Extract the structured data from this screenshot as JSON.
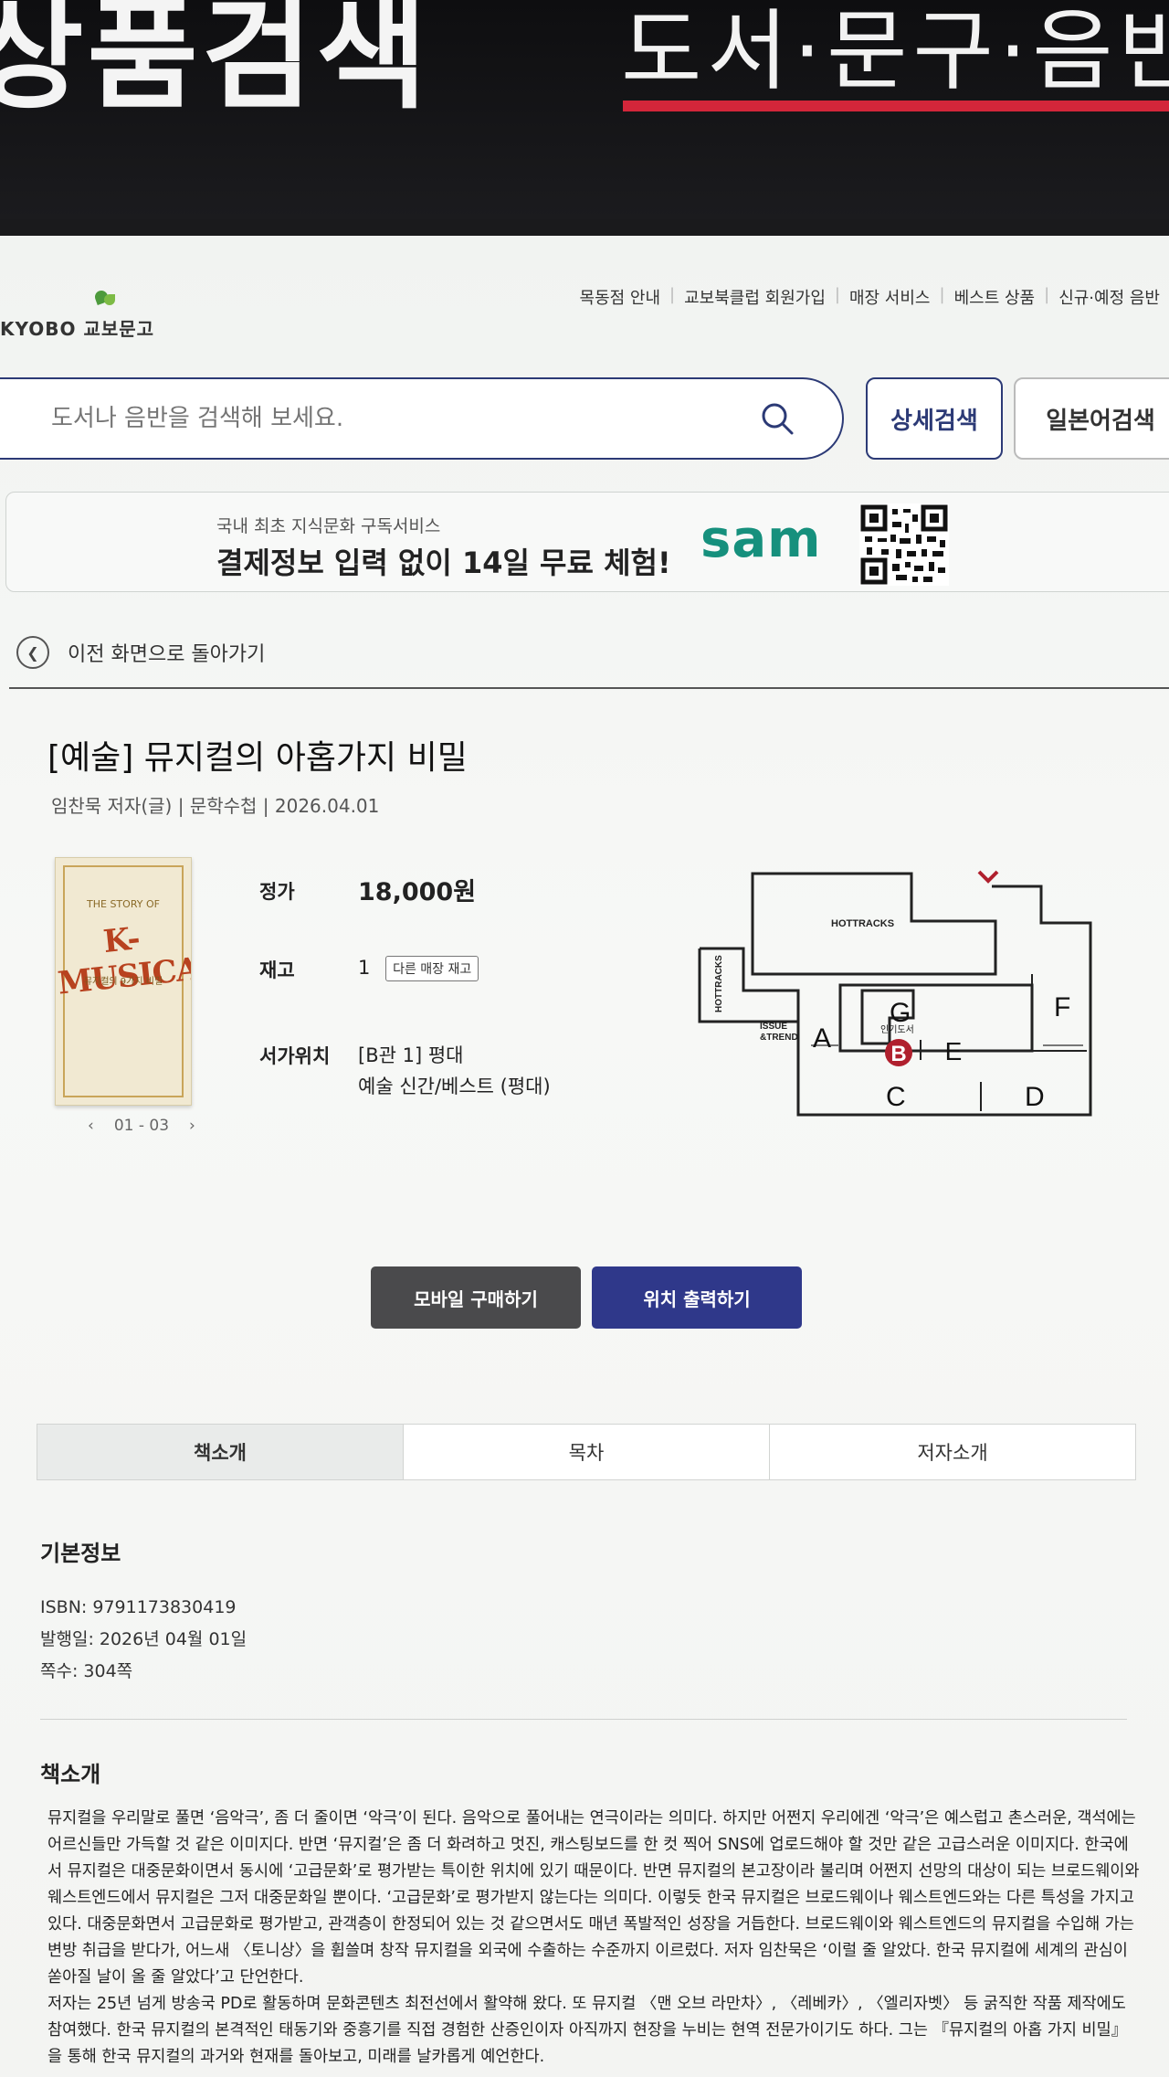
{
  "signage": {
    "left_text": "상품검색",
    "right_text": "도서·문구·음반"
  },
  "header": {
    "logo": "KYOBO 교보문고",
    "nav": [
      "목동점 안내",
      "교보북클럽 회원가입",
      "매장 서비스",
      "베스트 상품",
      "신규·예정 음반"
    ]
  },
  "search": {
    "placeholder": "도서나 음반을 검색해 보세요.",
    "detail_label": "상세검색",
    "japanese_label": "일본어검색"
  },
  "banner": {
    "subtitle": "국내 최초 지식문화 구독서비스",
    "headline": "결제정보 입력 없이 14일 무료 체험!",
    "brand": "sam"
  },
  "back_label": "이전 화면으로 돌아가기",
  "book": {
    "title": "[예술] 뮤지컬의 아홉가지 비밀",
    "meta": "임찬묵 저자(글) | 문학수첩 | 2026.04.01",
    "cover": {
      "small": "THE STORY OF",
      "main": "K-MUSICAL",
      "sub": "뮤지컬의 9가지 비밀"
    },
    "pager": "01 - 03",
    "price_label": "정가",
    "price": "18,000원",
    "stock_label": "재고",
    "stock": "1",
    "other_store_label": "다른 매장 재고",
    "shelf_label": "서가위치",
    "shelf_line1": "[B관 1] 평대",
    "shelf_line2": "예술 신간/베스트 (평대)"
  },
  "store_map": {
    "labels": {
      "hottracks_top": "HOTTRACKS",
      "hottracks_side": "HOTTRACKS",
      "issue": "ISSUE",
      "trend": "&TREND",
      "popular": "인기도서",
      "A": "A",
      "B": "B",
      "C": "C",
      "D": "D",
      "E": "E",
      "F": "F",
      "G": "G"
    },
    "highlight": "B",
    "highlight_color": "#b0202e"
  },
  "actions": {
    "mobile_buy": "모바일 구매하기",
    "print_location": "위치 출력하기"
  },
  "tabs": [
    {
      "label": "책소개",
      "active": true
    },
    {
      "label": "목차",
      "active": false
    },
    {
      "label": "저자소개",
      "active": false
    }
  ],
  "basic_info": {
    "title": "기본정보",
    "isbn": "ISBN: 9791173830419",
    "published": "발행일: 2026년 04월 01일",
    "pages": "쪽수: 304쪽"
  },
  "intro": {
    "title": "책소개",
    "p1": "뮤지컬을 우리말로 풀면 ‘음악극’, 좀 더 줄이면 ‘악극’이 된다. 음악으로 풀어내는 연극이라는 의미다. 하지만 어쩐지 우리에겐 ‘악극’은 예스럽고 촌스러운, 객석에는 어르신들만 가득할 것 같은 이미지다. 반면 ‘뮤지컬’은 좀 더 화려하고 멋진, 캐스팅보드를 한 컷 찍어 SNS에 업로드해야 할 것만 같은 고급스러운 이미지다. 한국에서 뮤지컬은 대중문화이면서 동시에 ‘고급문화’로 평가받는 특이한 위치에 있기 때문이다. 반면 뮤지컬의 본고장이라 불리며 어쩐지 선망의 대상이 되는 브로드웨이와 웨스트엔드에서 뮤지컬은 그저 대중문화일 뿐이다. ‘고급문화’로 평가받지 않는다는 의미다. 이렇듯 한국 뮤지컬은 브로드웨이나 웨스트엔드와는 다른 특성을 가지고 있다. 대중문화면서 고급문화로 평가받고, 관객층이 한정되어 있는 것 같으면서도 매년 폭발적인 성장을 거듭한다. 브로드웨이와 웨스트엔드의 뮤지컬을 수입해 가는 변방 취급을 받다가, 어느새 〈토니상〉을 휩쓸며 창작 뮤지컬을 외국에 수출하는 수준까지 이르렀다. 저자 임찬묵은 ‘이럴 줄 알았다. 한국 뮤지컬에 세계의 관심이 쏟아질 날이 올 줄 알았다’고 단언한다.",
    "p2": "저자는 25년 넘게 방송국 PD로 활동하며 문화콘텐츠 최전선에서 활약해 왔다. 또 뮤지컬 〈맨 오브 라만차〉, 〈레베카〉, 〈엘리자벳〉 등 굵직한 작품 제작에도 참여했다. 한국 뮤지컬의 본격적인 태동기와 중흥기를 직접 경험한 산증인이자 아직까지 현장을 누비는 현역 전문가이기도 하다. 그는 『뮤지컬의 아홉 가지 비밀』을 통해 한국 뮤지컬의 과거와 현재를 돌아보고, 미래를 날카롭게 예언한다."
  },
  "colors": {
    "brand_navy": "#2f388a",
    "sam_green": "#16907d",
    "dark_button": "#4a4a4c"
  }
}
